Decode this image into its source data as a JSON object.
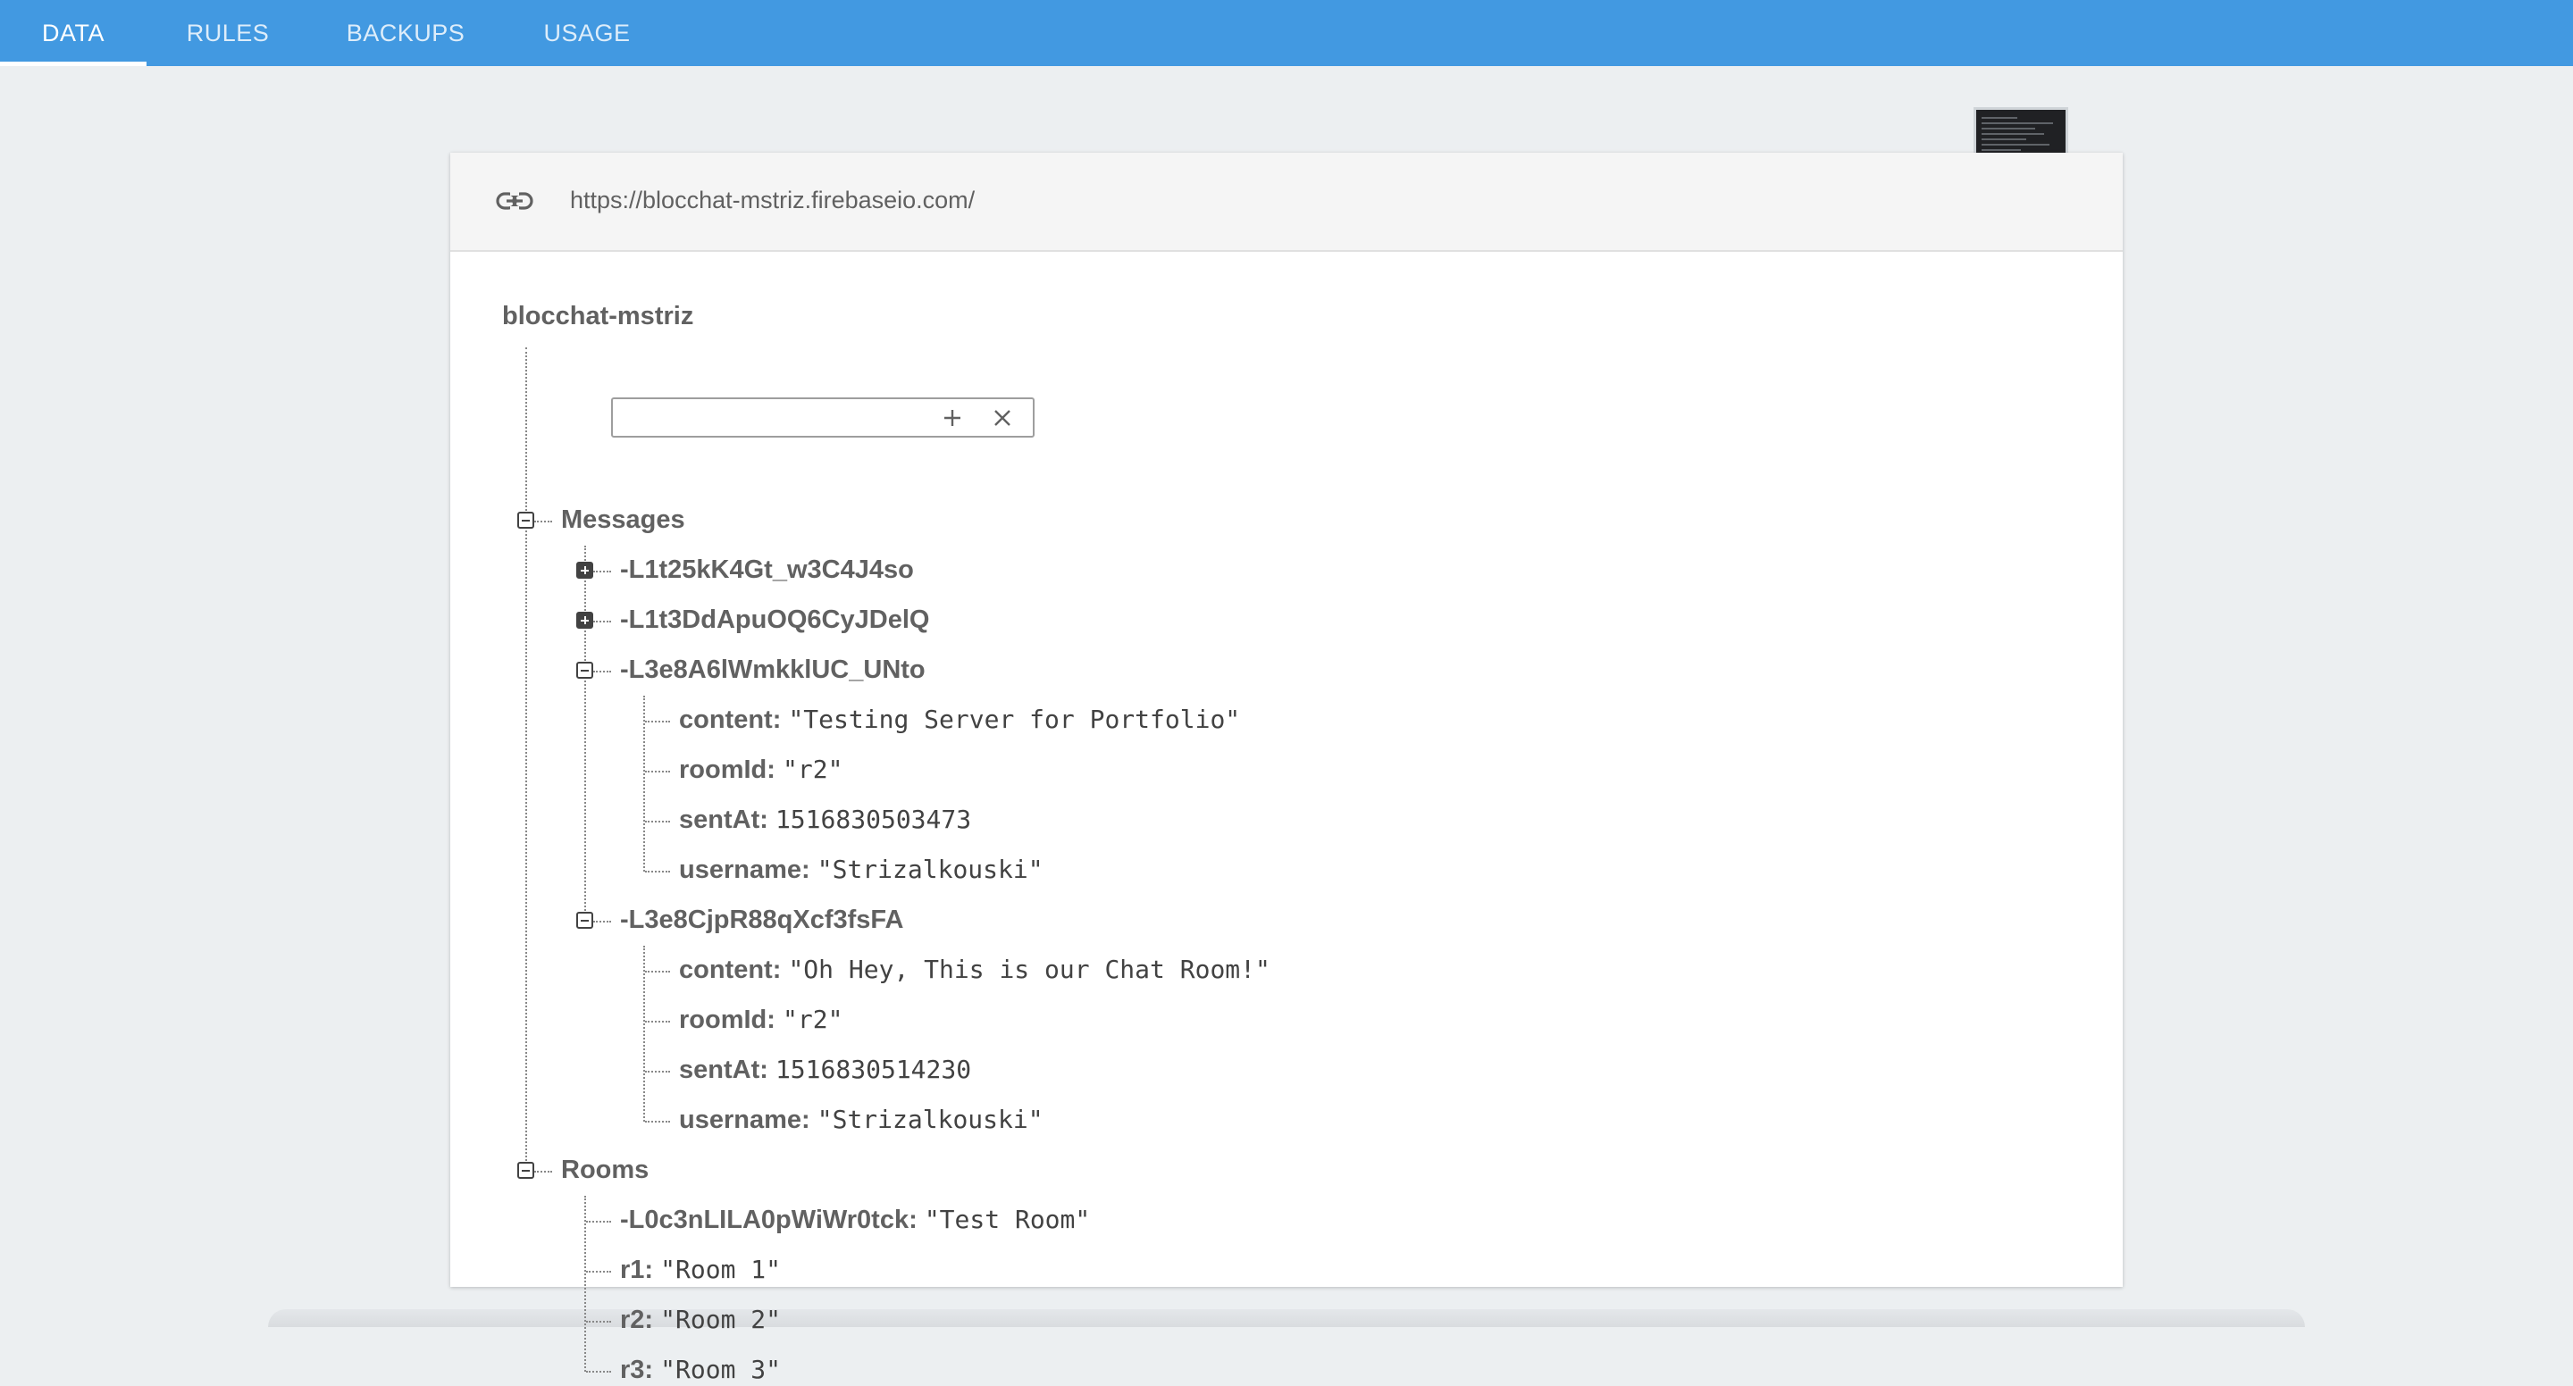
{
  "tabs": [
    {
      "label": "DATA",
      "active": true
    },
    {
      "label": "RULES",
      "active": false
    },
    {
      "label": "BACKUPS",
      "active": false
    },
    {
      "label": "USAGE",
      "active": false
    }
  ],
  "panel": {
    "url": "https://blocchat-mstriz.firebaseio.com/",
    "icons": {
      "link": "link-icon",
      "add": "plus-icon",
      "remove": "close-icon"
    }
  },
  "tree": {
    "root": "blocchat-mstriz",
    "messages": {
      "key": "Messages",
      "collapsed_1": "-L1t25kK4Gt_w3C4J4so",
      "collapsed_2": "-L1t3DdApuOQ6CyJDelQ",
      "msg_1": {
        "key": "-L3e8A6lWmkklUC_UNto",
        "content_key": "content:",
        "content": "\"Testing Server for Portfolio\"",
        "room_key": "roomId:",
        "room": "\"r2\"",
        "sent_key": "sentAt:",
        "sent": "1516830503473",
        "user_key": "username:",
        "user": "\"Strizalkouski\""
      },
      "msg_2": {
        "key": "-L3e8CjpR88qXcf3fsFA",
        "content_key": "content:",
        "content": "\"Oh Hey, This is our Chat Room!\"",
        "room_key": "roomId:",
        "room": "\"r2\"",
        "sent_key": "sentAt:",
        "sent": "1516830514230",
        "user_key": "username:",
        "user": "\"Strizalkouski\""
      }
    },
    "rooms": {
      "key": "Rooms",
      "items": [
        {
          "key": "-L0c3nLILA0pWiWr0tck:",
          "value": "\"Test Room\""
        },
        {
          "key": "r1:",
          "value": "\"Room 1\""
        },
        {
          "key": "r2:",
          "value": "\"Room 2\""
        },
        {
          "key": "r3:",
          "value": "\"Room 3\""
        }
      ]
    }
  }
}
